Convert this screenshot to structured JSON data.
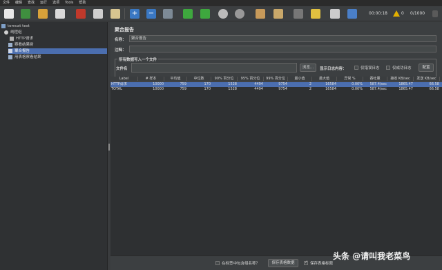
{
  "menu": [
    "文件",
    "编辑",
    "查找",
    "运行",
    "选项",
    "Tools",
    "帮助"
  ],
  "toolbar": {
    "timer": "00:00:18",
    "warnings": "0",
    "threads": "0/1000"
  },
  "tree": [
    {
      "label": "tomcat test"
    },
    {
      "label": "线程组"
    },
    {
      "label": "HTTP请求"
    },
    {
      "label": "察看结果树"
    },
    {
      "label": "聚合报告"
    },
    {
      "label": "用表格察看结果"
    }
  ],
  "panel": {
    "title": "聚合报告",
    "name_label": "名称：",
    "name_value": "聚合报告",
    "comment_label": "注释：",
    "comment_value": "",
    "group_title": "所有数据写入一个文件",
    "filename_label": "文件名",
    "filename_value": "",
    "browse_label": "浏览...",
    "log_label": "显示日志内容：",
    "only_errors_label": "仅错误日志",
    "only_success_label": "仅成功日志",
    "config_label": "配置"
  },
  "table": {
    "columns": [
      "Label",
      "# 样本",
      "平均值",
      "中位数",
      "90% 百分位",
      "95% 百分位",
      "99% 百分位",
      "最小值",
      "最大值",
      "异常 %",
      "吞吐量",
      "接收 KB/sec",
      "发送 KB/sec"
    ],
    "rows": [
      [
        "HTTP请求",
        "10000",
        "759",
        "170",
        "1528",
        "4494",
        "9754",
        "2",
        "16584",
        "0.00%",
        "587.4/sec",
        "1865.47",
        "66.58"
      ],
      [
        "TOTAL",
        "10000",
        "759",
        "170",
        "1528",
        "4494",
        "9754",
        "2",
        "16584",
        "0.00%",
        "587.4/sec",
        "1865.47",
        "66.58"
      ]
    ]
  },
  "bottom": {
    "include_group_label": "在标签中包含组名称？",
    "save_data_label": "保存表格数据",
    "save_header_label": "保存表格标题"
  },
  "watermark": "头条 @请叫我老菜鸟"
}
